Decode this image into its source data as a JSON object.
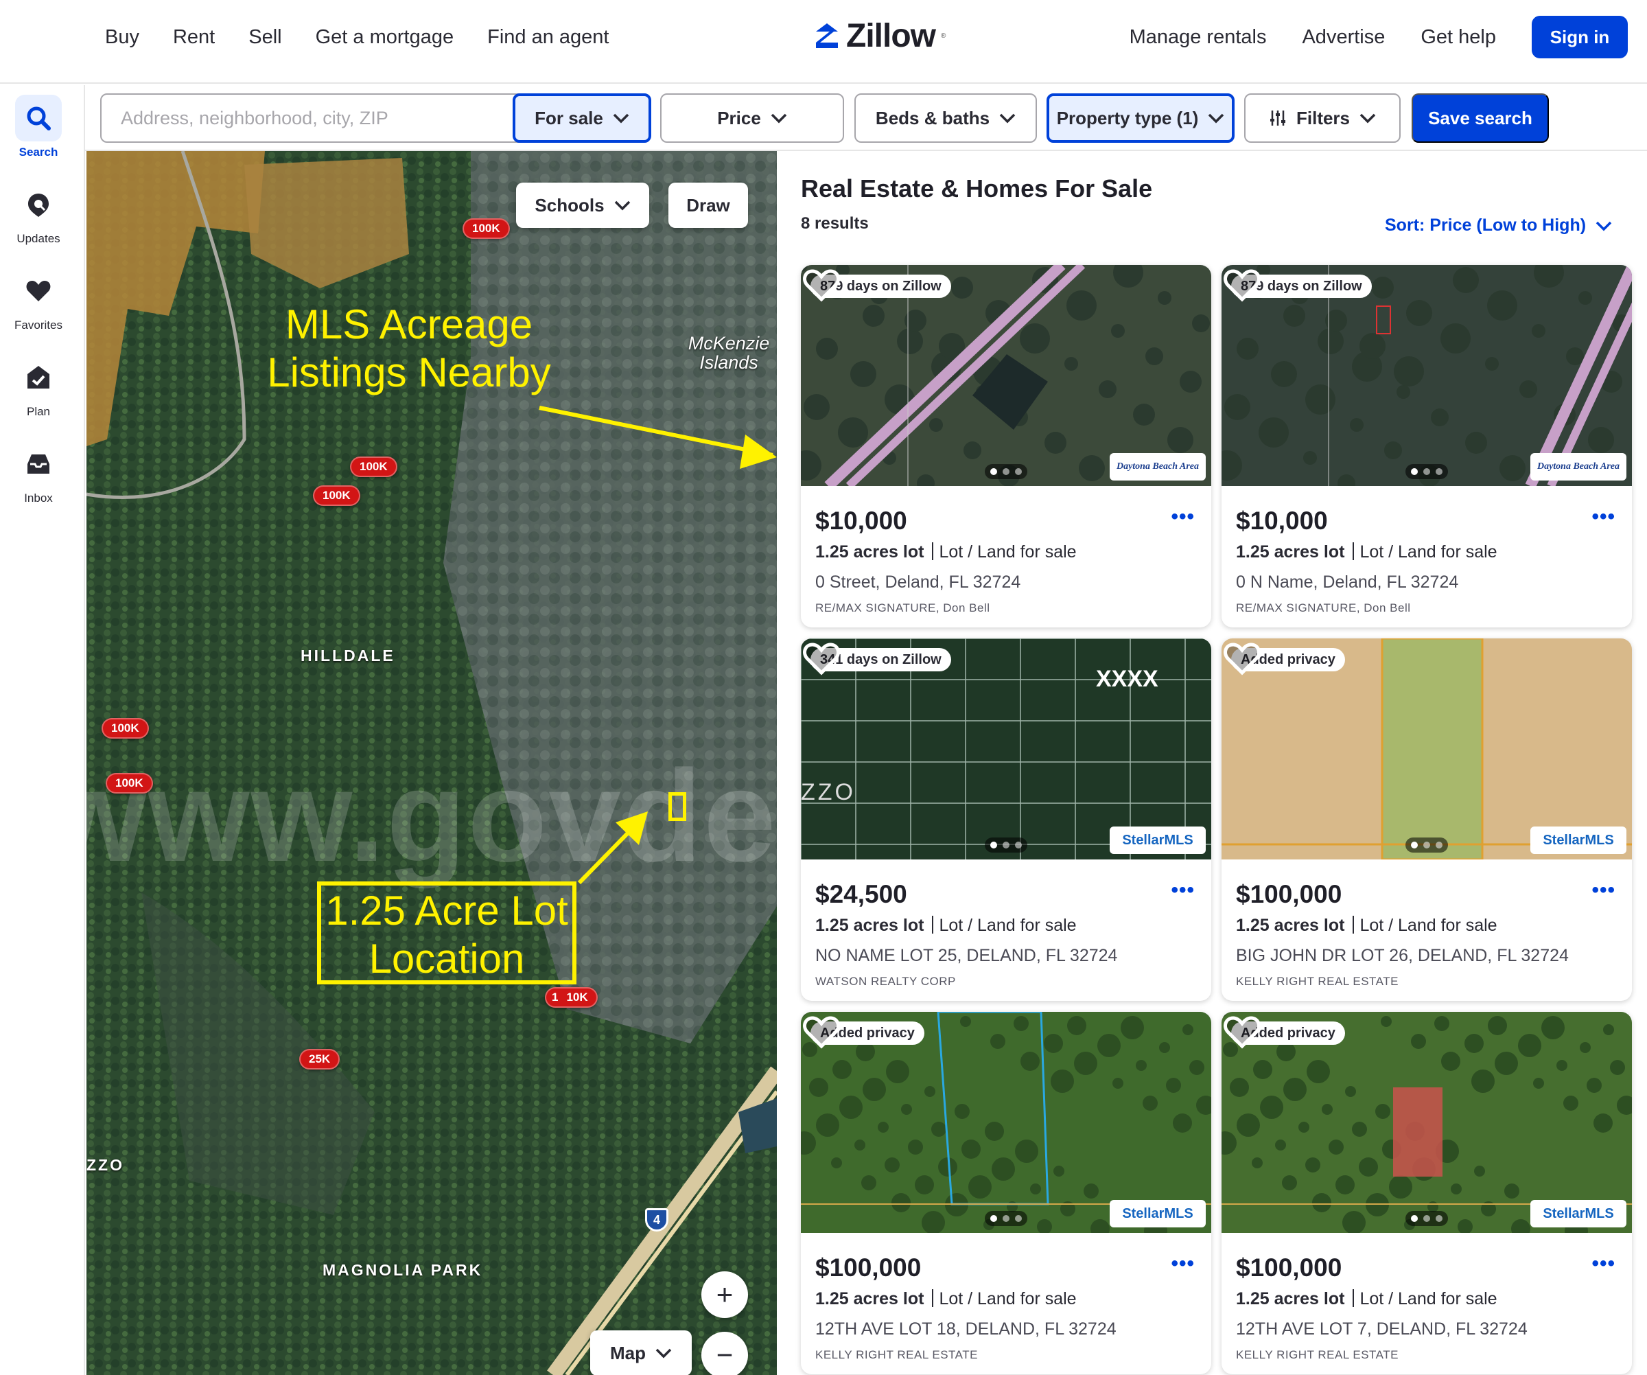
{
  "nav": {
    "left": [
      "Buy",
      "Rent",
      "Sell",
      "Get a mortgage",
      "Find an agent"
    ],
    "logo": "Zillow",
    "right": [
      "Manage rentals",
      "Advertise",
      "Get help"
    ],
    "sign_in": "Sign in"
  },
  "rail": [
    {
      "label": "Search",
      "icon": "search-icon",
      "active": true
    },
    {
      "label": "Updates",
      "icon": "updates-icon",
      "active": false
    },
    {
      "label": "Favorites",
      "icon": "heart-icon",
      "active": false
    },
    {
      "label": "Plan",
      "icon": "plan-icon",
      "active": false
    },
    {
      "label": "Inbox",
      "icon": "inbox-icon",
      "active": false
    }
  ],
  "filters": {
    "search_placeholder": "Address, neighborhood, city, ZIP",
    "for_sale": "For sale",
    "price": "Price",
    "beds_baths": "Beds & baths",
    "property_type": "Property type (1)",
    "more_filters": "Filters",
    "save_search": "Save search"
  },
  "map": {
    "schools_button": "Schools",
    "draw_button": "Draw",
    "map_type_button": "Map",
    "zoom_in": "+",
    "zoom_out": "−",
    "places": [
      "HILLDALE",
      "MAGNOLIA PARK",
      "McKenzie Islands",
      "ZZO"
    ],
    "markers": [
      "100K",
      "100K",
      "100K",
      "100K",
      "100K",
      "10K",
      "25K"
    ],
    "marker_cluster_count": "1",
    "highway_shield": "4",
    "annotation_listings": [
      "MLS Acreage",
      "Listings Nearby"
    ],
    "annotation_lot": [
      "1.25 Acre Lot",
      "Location"
    ],
    "watermark": "www.govdeals.com w"
  },
  "results": {
    "title": "Real Estate & Homes For Sale",
    "count": "8 results",
    "sort": "Sort: Price (Low to High)",
    "fact_suffix": "Lot / Land for sale",
    "listings": [
      {
        "badge": "879 days on Zillow",
        "price": "$10,000",
        "acres": "1.25 acres lot",
        "address": "0 Street, Deland, FL 32724",
        "broker": "RE/MAX SIGNATURE, Don Bell",
        "mls": "Daytona Beach Area",
        "image_overlay": ""
      },
      {
        "badge": "879 days on Zillow",
        "price": "$10,000",
        "acres": "1.25 acres lot",
        "address": "0 N Name, Deland, FL 32724",
        "broker": "RE/MAX SIGNATURE, Don Bell",
        "mls": "Daytona Beach Area",
        "image_overlay": ""
      },
      {
        "badge": "341 days on Zillow",
        "price": "$24,500",
        "acres": "1.25 acres lot",
        "address": "NO NAME LOT 25, DELAND, FL 32724",
        "broker": "WATSON REALTY CORP",
        "mls": "StellarMLS",
        "image_overlay": "XXXX"
      },
      {
        "badge": "Added privacy",
        "price": "$100,000",
        "acres": "1.25 acres lot",
        "address": "BIG JOHN DR LOT 26, DELAND, FL 32724",
        "broker": "KELLY RIGHT REAL ESTATE",
        "mls": "StellarMLS",
        "image_overlay": ""
      },
      {
        "badge": "Added privacy",
        "price": "$100,000",
        "acres": "1.25 acres lot",
        "address": "12TH AVE LOT 18, DELAND, FL 32724",
        "broker": "KELLY RIGHT REAL ESTATE",
        "mls": "StellarMLS",
        "image_overlay": ""
      },
      {
        "badge": "Added privacy",
        "price": "$100,000",
        "acres": "1.25 acres lot",
        "address": "12TH AVE LOT 7, DELAND, FL 32724",
        "broker": "KELLY RIGHT REAL ESTATE",
        "mls": "StellarMLS",
        "image_overlay": ""
      }
    ],
    "more_label": "•••"
  },
  "colors": {
    "brand": "#0041d9",
    "marker": "#d21515",
    "annotation": "#fff200"
  }
}
